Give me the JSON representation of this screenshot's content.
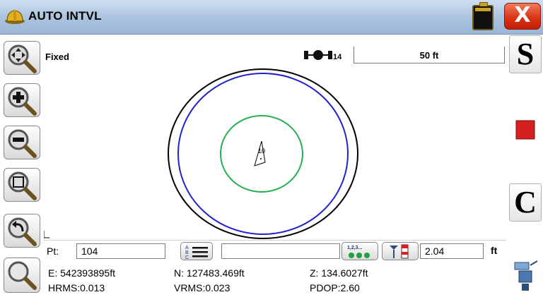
{
  "window": {
    "title": "AUTO INTVL",
    "app_icon": "hardhat-icon",
    "battery_icon": "battery-icon",
    "close_label": "X"
  },
  "left_toolbar": [
    {
      "name": "pan-zoom-button",
      "icon": "pan-arrows-magnifier-icon"
    },
    {
      "name": "zoom-in-button",
      "icon": "zoom-in-icon"
    },
    {
      "name": "zoom-out-button",
      "icon": "zoom-out-icon"
    },
    {
      "name": "zoom-window-button",
      "icon": "zoom-window-icon"
    },
    {
      "name": "zoom-previous-button",
      "icon": "zoom-previous-icon"
    },
    {
      "name": "zoom-extents-button",
      "icon": "zoom-extents-icon"
    }
  ],
  "right_toolbar": {
    "s_label": "S",
    "stop_icon": "stop-icon",
    "c_label": "C",
    "monitor_icon": "satellite-monitor-icon"
  },
  "status": {
    "solution": "Fixed",
    "satellites": "14",
    "satellite_icon": "satellite-icon",
    "scale": "50 ft"
  },
  "map": {
    "point_label": "10",
    "colors": {
      "outer": "#000000",
      "blue": "#2222cc",
      "green": "#22b14c"
    }
  },
  "point_row": {
    "pt_label": "Pt:",
    "pt_value": "104",
    "description_value": "",
    "description_list_icon": "abc-list-icon",
    "layer_icon": "numbered-points-icon",
    "rod_icon": "rod-height-icon",
    "height_value": "2.04",
    "height_unit": "ft"
  },
  "coords": {
    "easting": "E: 542393895ft",
    "northing": "N: 127483.469ft",
    "elevation": "Z: 134.6027ft",
    "hrms": "HRMS:0.013",
    "vrms": "VRMS:0.023",
    "pdop": "PDOP:2.60"
  }
}
